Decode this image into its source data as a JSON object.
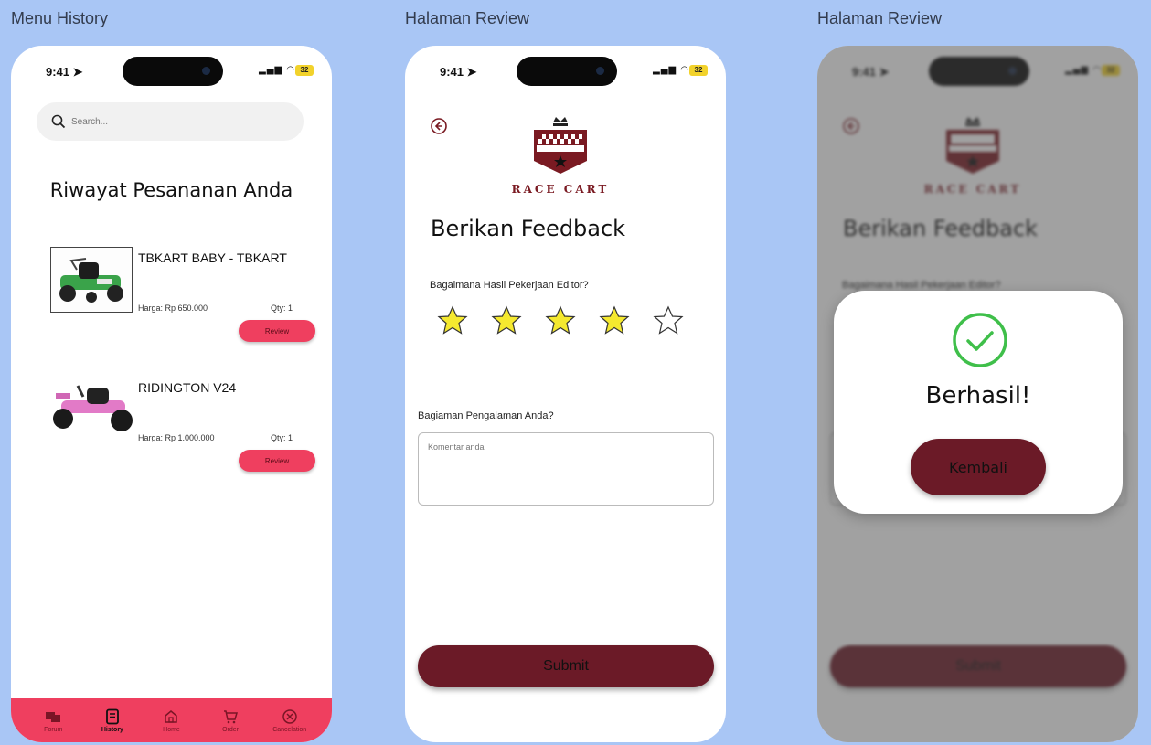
{
  "frames": {
    "history_label": "Menu History",
    "review_label": "Halaman Review",
    "success_label": "Halaman Review"
  },
  "status_bar": {
    "time": "9:41",
    "battery": "32"
  },
  "history": {
    "search_placeholder": "Search...",
    "title": "Riwayat Pesananan Anda",
    "orders": [
      {
        "name": "TBKART BABY - TBKART",
        "price": "Harga: Rp 650.000",
        "qty": "Qty: 1",
        "action": "Review"
      },
      {
        "name": "RIDINGTON V24",
        "price": "Harga: Rp 1.000.000",
        "qty": "Qty: 1",
        "action": "Review"
      }
    ],
    "tabs": [
      {
        "label": "Forum",
        "icon": "forum-icon"
      },
      {
        "label": "History",
        "icon": "history-icon",
        "active": true
      },
      {
        "label": "Home",
        "icon": "home-icon"
      },
      {
        "label": "Order",
        "icon": "cart-icon"
      },
      {
        "label": "Cancelation",
        "icon": "cancel-icon"
      }
    ]
  },
  "review": {
    "logo_text": "RACE CART",
    "title": "Berikan Feedback",
    "question_rating": "Bagaimana Hasil Pekerjaan Editor?",
    "rating": 4,
    "rating_max": 5,
    "question_experience": "Bagiaman Pengalaman Anda?",
    "comment_placeholder": "Komentar anda",
    "submit_label": "Submit"
  },
  "success": {
    "message": "Berhasil!",
    "back_label": "Kembali"
  },
  "colors": {
    "accent": "#ef3f5f",
    "primary": "#6b1a27",
    "star_fill": "#f5e92f",
    "success": "#3fbf4a",
    "canvas": "#a9c6f5"
  }
}
